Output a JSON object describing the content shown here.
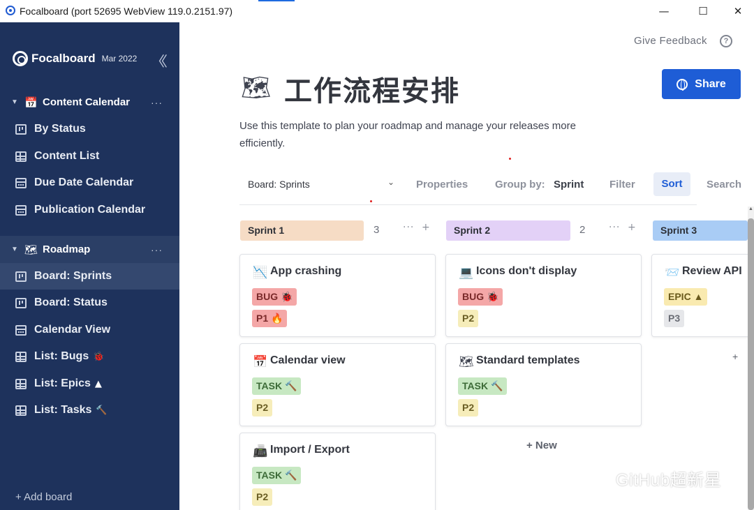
{
  "window": {
    "title": "Focalboard (port 52695 WebView 119.0.2151.97)",
    "minimize_glyph": "—",
    "maximize_glyph": "☐",
    "close_glyph": "✕"
  },
  "sidebar": {
    "logo_text": "Focalboard",
    "version": "Mar 2022",
    "collapse_glyph": "〈〈",
    "groups": [
      {
        "emoji": "📅",
        "label": "Content Calendar",
        "menu": "···",
        "views": [
          {
            "icon": "board-view-icon",
            "label": "By Status"
          },
          {
            "icon": "table-view-icon",
            "label": "Content List"
          },
          {
            "icon": "calendar-view-icon",
            "label": "Due Date Calendar"
          },
          {
            "icon": "calendar-view-icon",
            "label": "Publication Calendar"
          }
        ]
      },
      {
        "emoji": "🗺",
        "label": "Roadmap",
        "menu": "···",
        "views": [
          {
            "icon": "board-view-icon",
            "label": "Board: Sprints",
            "selected": true
          },
          {
            "icon": "board-view-icon",
            "label": "Board: Status"
          },
          {
            "icon": "calendar-view-icon",
            "label": "Calendar View"
          },
          {
            "icon": "table-view-icon",
            "label": "List: Bugs",
            "emoji": "🐞"
          },
          {
            "icon": "table-view-icon",
            "label": "List: Epics",
            "emoji": "▲"
          },
          {
            "icon": "table-view-icon",
            "label": "List: Tasks",
            "emoji": "🔨"
          }
        ]
      }
    ],
    "add_board": "+ Add board"
  },
  "header": {
    "feedback": "Give Feedback",
    "help_glyph": "?",
    "page_emoji": "🗺",
    "title": "工作流程安排",
    "share_label": "Share",
    "description": "Use this template to plan your roadmap and manage your releases more efficiently."
  },
  "toolbar": {
    "view_name": "Board: Sprints",
    "chevron": "⌄",
    "properties": "Properties",
    "group_by_label": "Group by:",
    "group_by_value": "Sprint",
    "filter": "Filter",
    "sort": "Sort",
    "search": "Search"
  },
  "columns": [
    {
      "name": "Sprint 1",
      "count": "3",
      "color": "#f6dcc5",
      "menu": "···",
      "add": "+"
    },
    {
      "name": "Sprint 2",
      "count": "2",
      "color": "#e3d1f7",
      "menu": "···",
      "add": "+"
    },
    {
      "name": "Sprint 3",
      "color": "#a9ccf5"
    }
  ],
  "cards": [
    {
      "emoji": "📉",
      "title": "App crashing",
      "tags": [
        {
          "text": "BUG 🐞",
          "kind": "bug"
        },
        {
          "text": "P1 🔥",
          "kind": "p1"
        }
      ]
    },
    {
      "emoji": "📅",
      "title": "Calendar view",
      "tags": [
        {
          "text": "TASK 🔨",
          "kind": "task"
        },
        {
          "text": "P2",
          "kind": "p2"
        }
      ]
    },
    {
      "emoji": "📠",
      "title": "Import / Export",
      "tags": [
        {
          "text": "TASK 🔨",
          "kind": "task"
        },
        {
          "text": "P2",
          "kind": "p2"
        }
      ]
    },
    {
      "emoji": "💻",
      "title": "Icons don't display",
      "tags": [
        {
          "text": "BUG 🐞",
          "kind": "bug"
        },
        {
          "text": "P2",
          "kind": "p2"
        }
      ]
    },
    {
      "emoji": "🗺",
      "title": "Standard templates",
      "tags": [
        {
          "text": "TASK 🔨",
          "kind": "task"
        },
        {
          "text": "P2",
          "kind": "p2"
        }
      ]
    },
    {
      "emoji": "📨",
      "title": "Review API",
      "tags": [
        {
          "text": "EPIC ▲",
          "kind": "epic"
        },
        {
          "text": "P3",
          "kind": "p3"
        }
      ]
    }
  ],
  "board": {
    "new_label": "+ New",
    "side_plus": "+"
  },
  "watermark": "GitHub超新星"
}
